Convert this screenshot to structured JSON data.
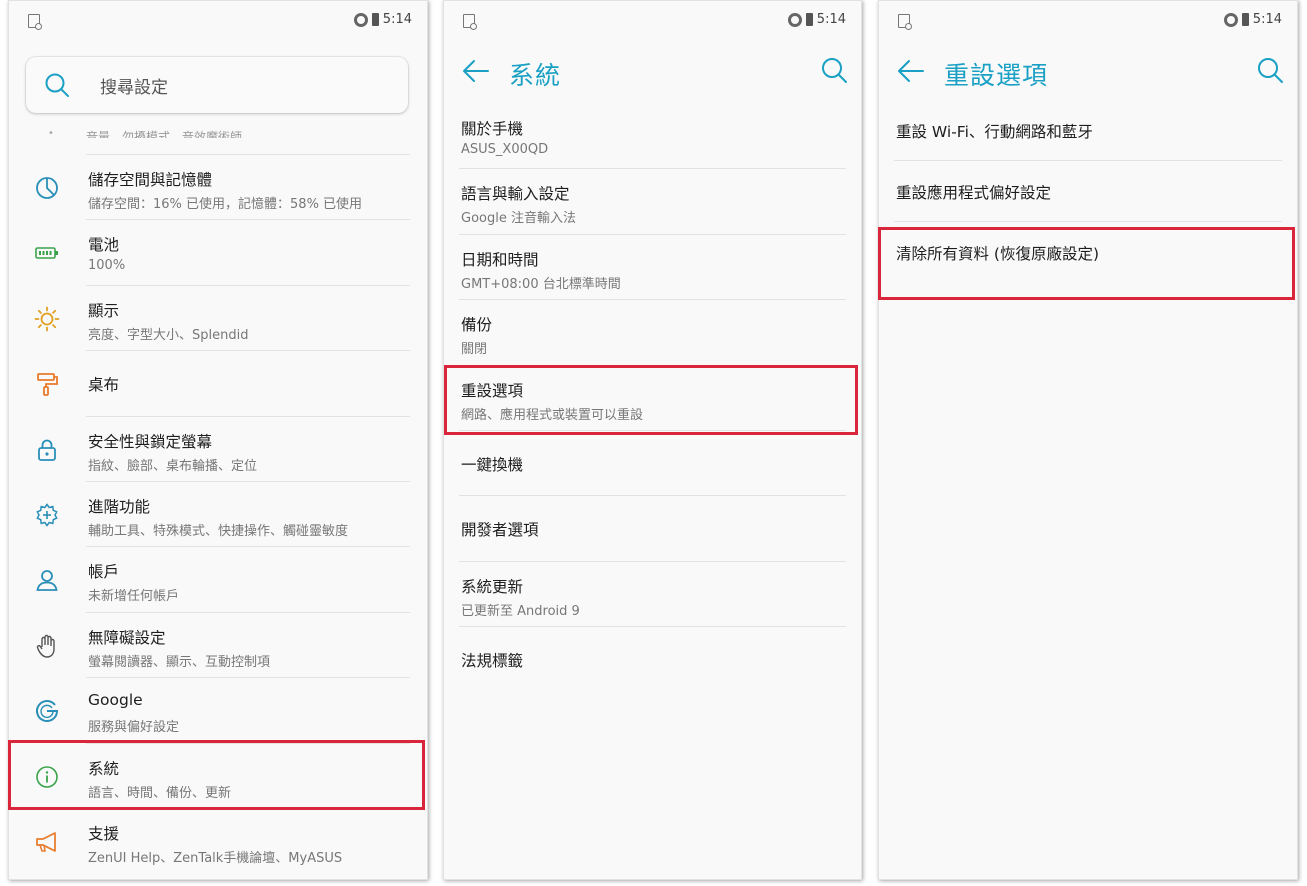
{
  "status_bar": {
    "time": "5:14"
  },
  "screen1": {
    "search_placeholder": "搜尋設定",
    "faded_row_text": "音量、勿擾模式、音效魔術師",
    "items": [
      {
        "icon": "storage-icon",
        "title": "儲存空間與記憶體",
        "subtitle": "儲存空間：16% 已使用，記憶體：58% 已使用"
      },
      {
        "icon": "battery-icon",
        "title": "電池",
        "subtitle": "100%"
      },
      {
        "icon": "brightness-icon",
        "title": "顯示",
        "subtitle": "亮度、字型大小、Splendid"
      },
      {
        "icon": "paint-roller-icon",
        "title": "桌布",
        "subtitle": ""
      },
      {
        "icon": "lock-icon",
        "title": "安全性與鎖定螢幕",
        "subtitle": "指紋、臉部、桌布輪播、定位"
      },
      {
        "icon": "gear-plus-icon",
        "title": "進階功能",
        "subtitle": "輔助工具、特殊模式、快捷操作、觸碰靈敏度"
      },
      {
        "icon": "person-icon",
        "title": "帳戶",
        "subtitle": "未新增任何帳戶"
      },
      {
        "icon": "hand-icon",
        "title": "無障礙設定",
        "subtitle": "螢幕閱讀器、顯示、互動控制項"
      },
      {
        "icon": "google-icon",
        "title": "Google",
        "subtitle": "服務與偏好設定"
      },
      {
        "icon": "info-icon",
        "title": "系統",
        "subtitle": "語言、時間、備份、更新"
      },
      {
        "icon": "megaphone-icon",
        "title": "支援",
        "subtitle": "ZenUI Help、ZenTalk手機論壇、MyASUS"
      }
    ]
  },
  "screen2": {
    "title": "系統",
    "items": [
      {
        "title": "關於手機",
        "subtitle": "ASUS_X00QD"
      },
      {
        "title": "語言與輸入設定",
        "subtitle": "Google 注音輸入法"
      },
      {
        "title": "日期和時間",
        "subtitle": "GMT+08:00 台北標準時間"
      },
      {
        "title": "備份",
        "subtitle": "關閉"
      },
      {
        "title": "重設選項",
        "subtitle": "網路、應用程式或裝置可以重設"
      },
      {
        "title": "一鍵換機",
        "subtitle": ""
      },
      {
        "title": "開發者選項",
        "subtitle": ""
      },
      {
        "title": "系統更新",
        "subtitle": "已更新至 Android 9"
      },
      {
        "title": "法規標籤",
        "subtitle": ""
      }
    ]
  },
  "screen3": {
    "title": "重設選項",
    "items": [
      {
        "title": "重設 Wi-Fi、行動網路和藍牙"
      },
      {
        "title": "重設應用程式偏好設定"
      },
      {
        "title": "清除所有資料 (恢復原廠設定)"
      }
    ]
  },
  "colors": {
    "accent": "#1aa0c4",
    "icon": "#2a8fb8",
    "highlight": "#d9263a",
    "battery": "#3aa34a",
    "sun": "#e0a020",
    "roller": "#e87a2a"
  }
}
